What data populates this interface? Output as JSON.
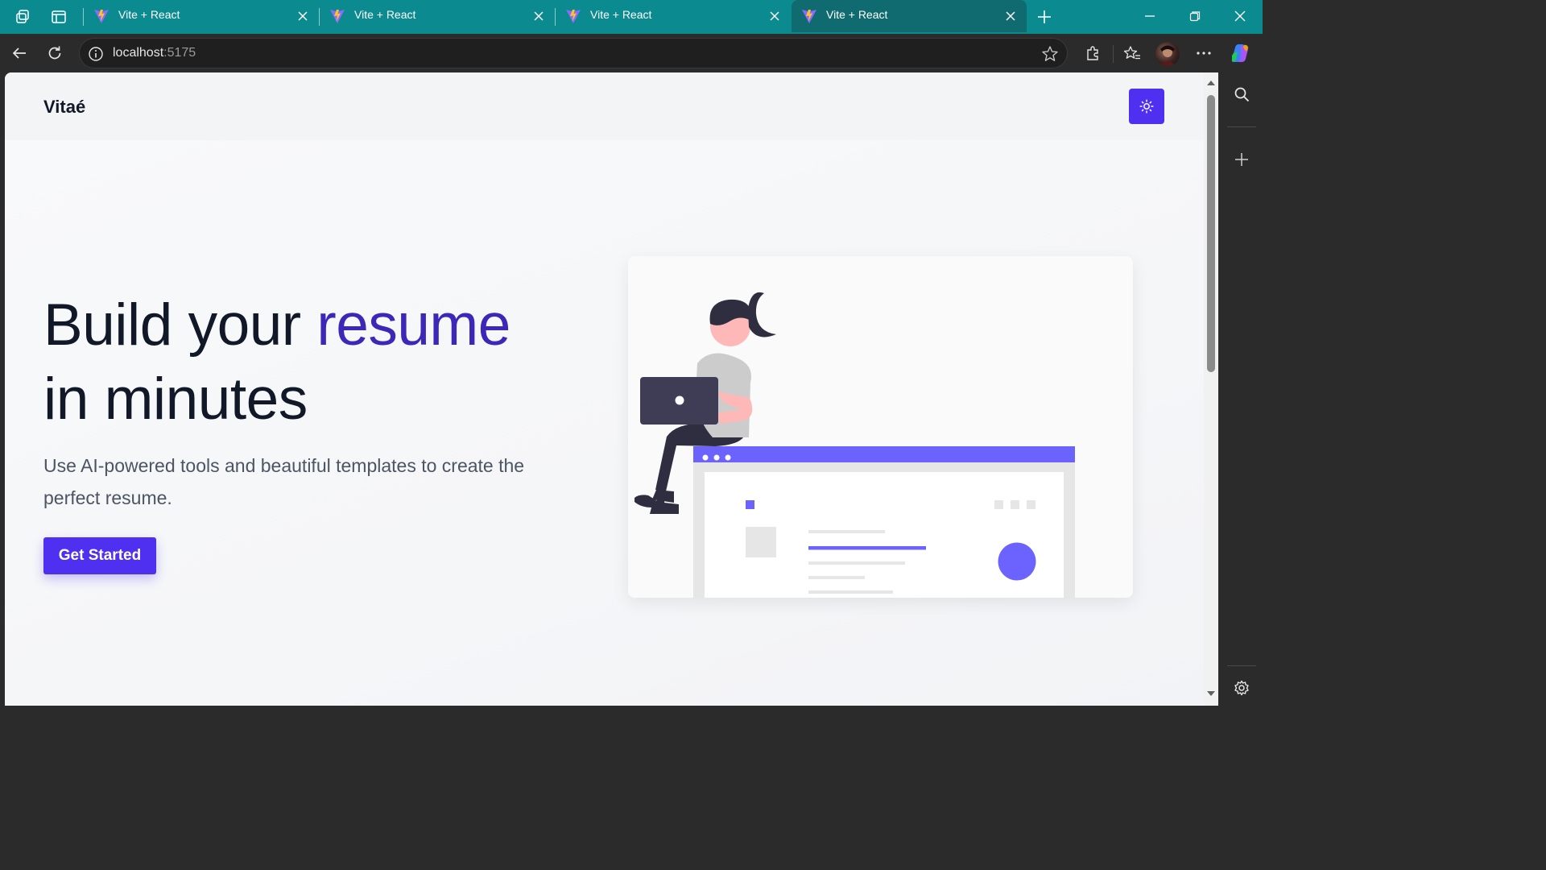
{
  "browser": {
    "tabs": [
      {
        "title": "Vite + React",
        "active": false
      },
      {
        "title": "Vite + React",
        "active": false
      },
      {
        "title": "Vite + React",
        "active": false
      },
      {
        "title": "Vite + React",
        "active": true
      }
    ],
    "address": {
      "host": "localhost",
      "port": ":5175"
    },
    "colors": {
      "tab_strip": "#0b8a8f",
      "toolbar": "#2b2b2b"
    }
  },
  "site": {
    "logo": "Vitaé",
    "theme_toggle_icon": "sun-icon",
    "hero": {
      "headline_part1": "Build your ",
      "headline_accent": "resume",
      "headline_part2": "in minutes",
      "subtext": "Use AI-powered tools and beautiful templates to create the perfect resume.",
      "cta_label": "Get Started"
    },
    "colors": {
      "primary": "#4f2ff0",
      "accent_text": "#3b27b8",
      "illustration_accent": "#6c63ff"
    }
  }
}
